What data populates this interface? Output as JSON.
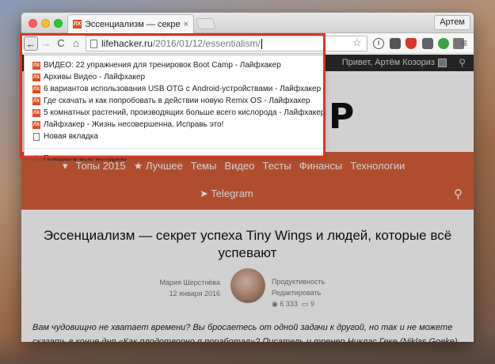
{
  "browser": {
    "tab": {
      "favicon": "ЛХ",
      "title": "Эссенциализм — секрет",
      "close": "×"
    },
    "profile_label": "Артем",
    "toolbar": {
      "back": "←",
      "forward": "→",
      "reload": "C",
      "home": "⌂",
      "url_host": "lifehacker.ru",
      "url_path": "/2016/01/12/essentialism/",
      "star": "☆",
      "menu": "≡"
    },
    "extensions": [
      "info-icon",
      "pocket-icon",
      "shield-icon",
      "check-icon",
      "green-extension-icon",
      "cube-icon"
    ]
  },
  "omnibox_dropdown": {
    "items": [
      {
        "icon": "lifehacker-favicon",
        "favicon": "ЛХ",
        "text": "ВИДЕО: 22 упражнения для тренировок Boot Camp - Лайфхакер"
      },
      {
        "icon": "lifehacker-favicon",
        "favicon": "ЛХ",
        "text": "Архивы Видео - Лайфхакер"
      },
      {
        "icon": "lifehacker-favicon",
        "favicon": "ЛХ",
        "text": "6 вариантов использования USB OTG с Android-устройствами - Лайфхакер"
      },
      {
        "icon": "lifehacker-favicon",
        "favicon": "ЛХ",
        "text": "Где скачать и как попробовать в действии новую Remix OS - Лайфхакер"
      },
      {
        "icon": "lifehacker-favicon",
        "favicon": "ЛХ",
        "text": "5 комнатных растений, производящих больше всего кислорода - Лайфхакер"
      },
      {
        "icon": "lifehacker-favicon",
        "favicon": "ЛХ",
        "text": "Лайфхакер - Жизнь несовершенна. Исправь это!"
      },
      {
        "icon": "page-icon",
        "favicon": "",
        "text": "Новая вкладка"
      }
    ],
    "show_history": "Показать всю историю"
  },
  "site": {
    "greeting": "Привет, Артём Козориз",
    "logo_fragment": "P",
    "nav": [
      "Топы 2015",
      "Лучшее",
      "Темы",
      "Видео",
      "Тесты",
      "Финансы",
      "Технологии"
    ],
    "telegram": "Telegram",
    "article": {
      "title": "Эссенциализм — секрет успеха Tiny Wings и людей, которые всё успевают",
      "author": "Мария Шерстнёва",
      "date": "12 января 2016",
      "category": "Продуктивность",
      "edit": "Редактировать",
      "views": "6 333",
      "comments": "9",
      "lead": "Вам чудовищно не хватает времени? Вы бросаетесь от одной задачи к другой, но так и не можете сказать в конце дня «Как плодотворно я поработал»? Писатель и тренер Никлас Геке (Niklas Goeke)"
    }
  },
  "colors": {
    "accent": "#d6603a",
    "highlight": "#e0341e",
    "topbar": "#2c2c2c"
  }
}
